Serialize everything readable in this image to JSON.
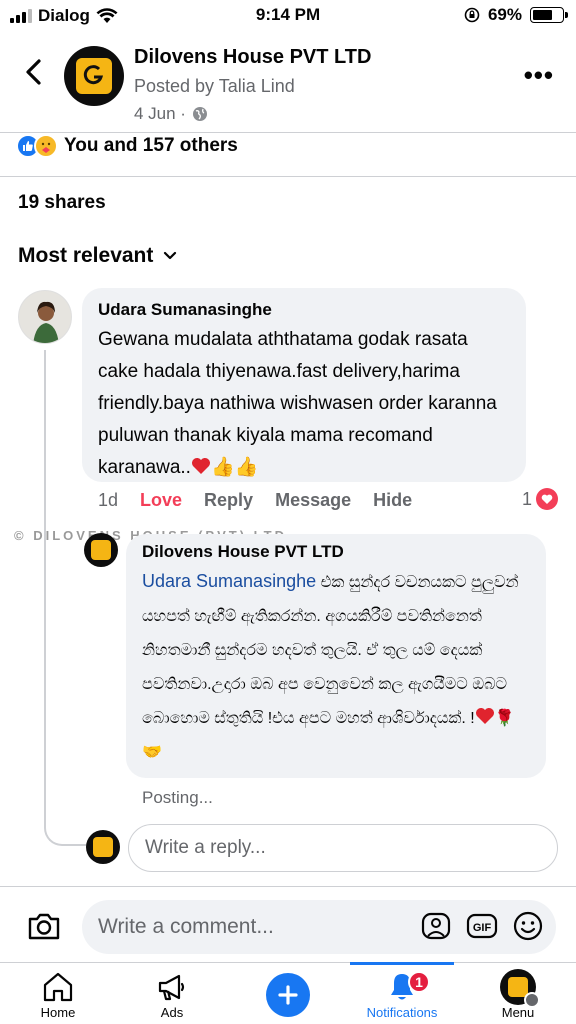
{
  "status_bar": {
    "carrier": "Dialog",
    "time": "9:14 PM",
    "battery": "69%",
    "battery_level": 0.69
  },
  "post": {
    "page_name": "Dilovens House PVT LTD",
    "posted_by": "Posted by Talia Lind",
    "date": "4 Jun ·",
    "reactions_text": "You and 157 others",
    "shares": "19 shares"
  },
  "sort_label": "Most relevant",
  "comment": {
    "author": "Udara Sumanasinghe",
    "text": "Gewana mudalata aththatama godak rasata cake hadala thiyenawa.fast delivery,harima friendly.baya nathiwa wishwasen order karanna puluwan thanak  kiyala mama recomand karanawa..",
    "emojis": "👍👍",
    "time": "1d",
    "actions": {
      "love": "Love",
      "reply": "Reply",
      "message": "Message",
      "hide": "Hide"
    },
    "reaction_count": "1"
  },
  "watermark": "© DILOVENS HOUSE (PVT) LTD",
  "reply": {
    "author": "Dilovens House PVT LTD",
    "mention": "Udara Sumanasinghe",
    "text": " එක සුන්දර වචනයකට පුලුවන් යහපත් හැඟීම් ඇතිකරන්න. අගයකිරීම් පවතින්නෙත් නිහතමානී  සුන්දරම හදවත් තුලයි. ඒ තුල යම් දෙයක් පවතිනවා.උදාරා ඔබ අප වෙනුවෙන් කල ඇගයීමට ඔබට බොහොම ස්තුතියි !එය අපට මහත් ආශිර්වාදයක්. !",
    "emojis": "🌹🤝",
    "status": "Posting..."
  },
  "reply_input": {
    "placeholder": "Write a reply..."
  },
  "comment_input": {
    "placeholder": "Write a comment...",
    "gif_label": "GIF"
  },
  "tabs": {
    "home": "Home",
    "ads": "Ads",
    "notifications": "Notifications",
    "notifications_badge": "1",
    "menu": "Menu"
  },
  "colors": {
    "accent": "#1877f2",
    "love": "#f33e58",
    "bubble": "#f0f2f5",
    "brand_yellow": "#f5b514"
  }
}
